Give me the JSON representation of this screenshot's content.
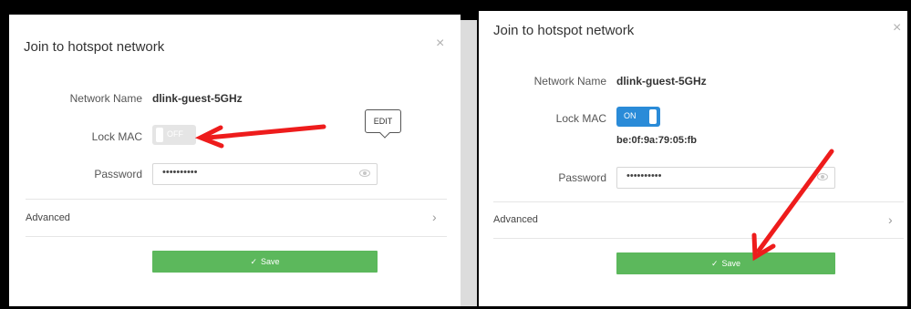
{
  "left_dialog": {
    "title": "Join to hotspot network",
    "close_label": "×",
    "network_name_label": "Network Name",
    "network_name_value": "dlink-guest-5GHz",
    "lock_mac_label": "Lock MAC",
    "lock_mac_state": "OFF",
    "password_label": "Password",
    "password_value": "••••••••••",
    "advanced_label": "Advanced",
    "advanced_chevron": "›",
    "save_check": "✓",
    "save_label": "Save",
    "edit_label": "EDIT"
  },
  "right_dialog": {
    "title": "Join to hotspot network",
    "close_label": "×",
    "network_name_label": "Network Name",
    "network_name_value": "dlink-guest-5GHz",
    "lock_mac_label": "Lock MAC",
    "lock_mac_state": "ON",
    "mac_address": "be:0f:9a:79:05:fb",
    "password_label": "Password",
    "password_value": "••••••••••",
    "advanced_label": "Advanced",
    "advanced_chevron": "›",
    "save_check": "✓",
    "save_label": "Save"
  },
  "colors": {
    "save_button": "#5cb85c",
    "toggle_on": "#2a8bd8",
    "toggle_off": "#e5e5e5",
    "annotation_arrow": "#ee1c1c"
  },
  "icons": [
    "close-icon",
    "eye-icon",
    "chevron-right-icon",
    "check-icon",
    "red-arrow-annotation"
  ]
}
